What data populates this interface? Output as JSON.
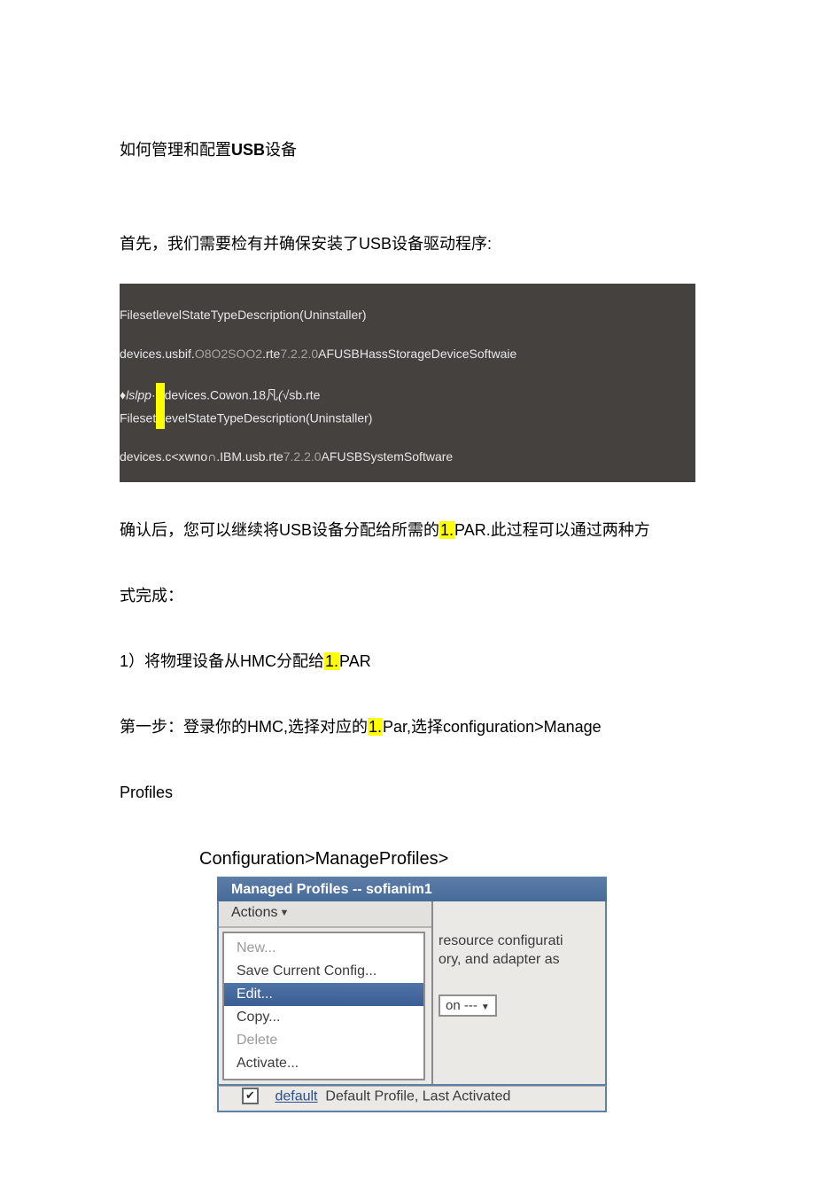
{
  "doc": {
    "title_pre": "如何管理和配置",
    "title_bold": "USB",
    "title_post": "设备",
    "p1": "首先，我们需要检有并确保安装了USB设备驱动程序:",
    "code": {
      "l1": "FilesetlevelStateTypeDescription(Uninstaller)",
      "l2a": "devices.usbif.",
      "l2b": "O8O2SOO2",
      "l2c": ".rte",
      "l2d": "7.2.2.0",
      "l2e": "AFUSBHassStorageDeviceSoftwaie",
      "l3a": "♦",
      "l3b": "lslpp",
      "l3c": "·",
      "l3d": "devices.Cowon.18凡",
      "l3e": "(√",
      "l3f": "sb.rte",
      "l4": "FilesetlevelStateTypeDescription(Uninstaller)",
      "l5a": "devices.c<xwno∩.IBM.usb.rte",
      "l5b": "7.2.2.0",
      "l5c": "AFUSBSystemSoftware"
    },
    "p2a": "确认后，您可以继续将USB设备分配给所需的",
    "p2hl": "1.",
    "p2b": "PAR.此过程可以通过两种方",
    "p3": "式完成：",
    "p4a": "1）将物理设备从HMC分配给",
    "p4hl": "1.",
    "p4b": "PAR",
    "p5a": "第一步：登录你的HMC,选择对应的",
    "p5hl": "1.",
    "p5b": "Par,选择configuration>Manage",
    "p6": "Profiles",
    "shot_caption": "Configuration>ManageProfiles>",
    "shot": {
      "title": "Managed Profiles -- sofianim1",
      "actions": "Actions",
      "items": {
        "new": "New...",
        "save": "Save Current Config...",
        "edit": "Edit...",
        "copy": "Copy...",
        "delete": "Delete",
        "activate": "Activate..."
      },
      "right1": "resource configurati",
      "right2": "ory, and adapter as",
      "combo": "on ---",
      "footer_link": "default",
      "footer_text": "Default Profile, Last Activated"
    }
  }
}
